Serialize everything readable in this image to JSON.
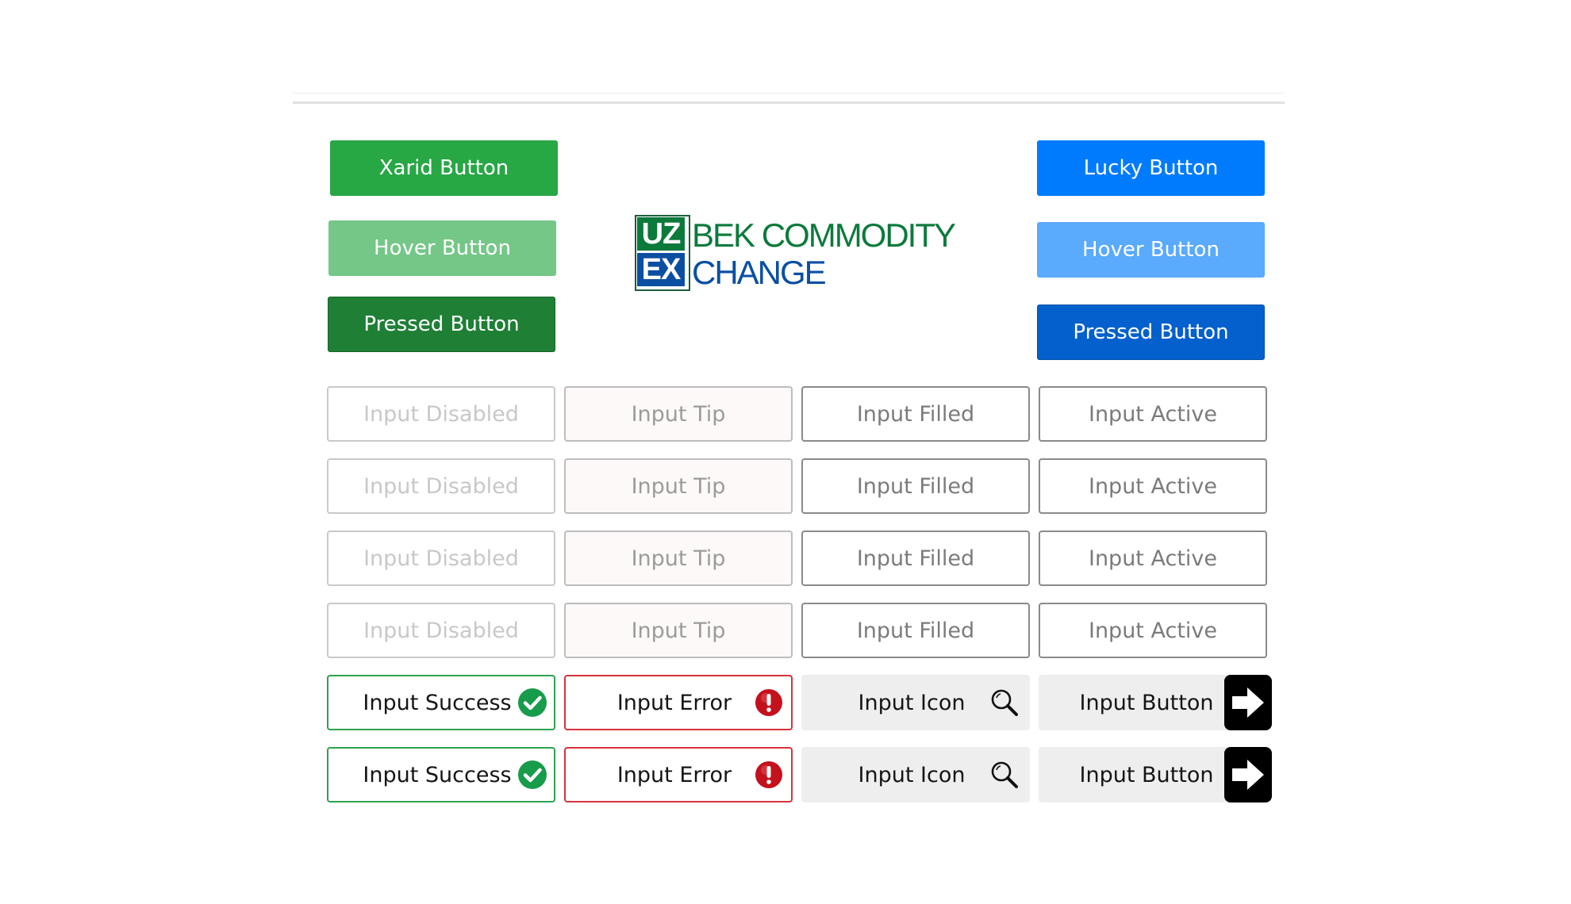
{
  "buttons": {
    "green": {
      "default_label": "Xarid Button",
      "hover_label": "Hover Button",
      "pressed_label": "Pressed Button"
    },
    "blue": {
      "default_label": "Lucky Button",
      "hover_label": "Hover Button",
      "pressed_label": "Pressed Button"
    }
  },
  "logo": {
    "box_top": "UZ",
    "box_bottom": "EX",
    "line1": "BEK COMMODITY",
    "line2": "CHANGE",
    "color_green": "#0b7a3b",
    "color_blue": "#0b4fa2"
  },
  "inputs": {
    "disabled": "Input Disabled",
    "tip": "Input Tip",
    "filled": "Input Filled",
    "active": "Input Active",
    "success": "Input Success",
    "error": "Input Error",
    "icon": "Input Icon",
    "button": "Input Button"
  },
  "icons": {
    "success": "check-circle-icon",
    "error": "exclamation-circle-icon",
    "icon": "search-icon",
    "button": "arrow-right-icon"
  },
  "colors": {
    "green_primary": "#28a745",
    "green_hover": "#74c787",
    "green_pressed": "#1e7f35",
    "blue_primary": "#007bfe",
    "blue_hover": "#5aaafe",
    "blue_pressed": "#0360cc",
    "success_border": "#2fa24f",
    "error_border": "#d8323c"
  }
}
